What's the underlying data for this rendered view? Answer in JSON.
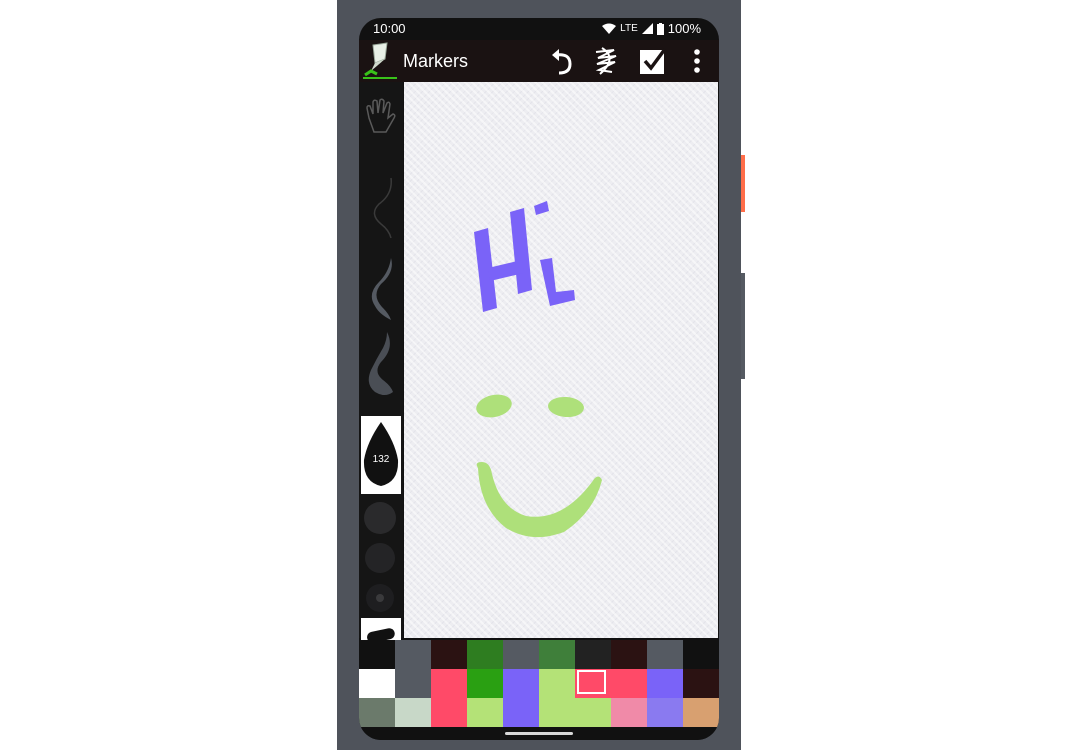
{
  "status_bar": {
    "time": "10:00",
    "network": "LTE",
    "battery": "100%"
  },
  "app_bar": {
    "title": "Markers",
    "actions": [
      "undo",
      "clear-canvas",
      "done",
      "more-options"
    ]
  },
  "tools": {
    "selected_brush_size": "132",
    "items": [
      "pan-hand",
      "thin-stroke",
      "medium-stroke",
      "thick-stroke",
      "brush-size-132",
      "dot-large",
      "dot-medium",
      "dot-small",
      "marker-tip"
    ]
  },
  "canvas": {
    "drawing_text": "Hi",
    "text_color": "#7a63f8",
    "smiley_color": "#aee07a"
  },
  "palette": {
    "selected_index": 16,
    "rows": [
      [
        "#111111",
        "#555a62",
        "#2b1212",
        "#2e7d20",
        "#555a62",
        "#3f7f3a",
        "#222222",
        "#2b1212",
        "#555a62",
        "#111111"
      ],
      [
        "#ffffff",
        "#555a62",
        "#ff4a68",
        "#2aa012",
        "#7a63f8",
        "#b4e277",
        "#ff4a68",
        "#ff4a68",
        "#7a63f8",
        "#2b1212"
      ],
      [
        "#6b7a6b",
        "#c8d8c8",
        "#ff4a68",
        "#b4e277",
        "#7a63f8",
        "#b4e277",
        "#b4e277",
        "#f08aa8",
        "#8a7af0",
        "#d8a070"
      ]
    ]
  }
}
